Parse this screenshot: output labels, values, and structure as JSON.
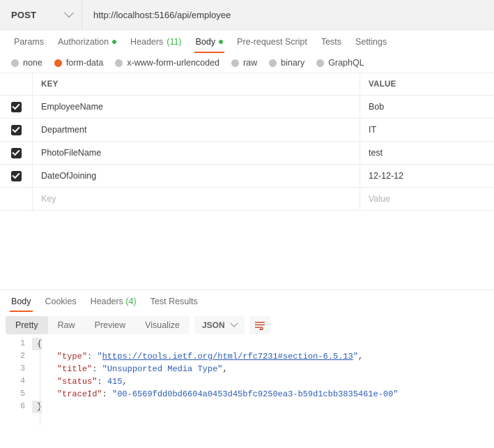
{
  "request": {
    "method": "POST",
    "url": "http://localhost:5166/api/employee",
    "tabs": [
      {
        "label": "Params",
        "dot": false,
        "count": ""
      },
      {
        "label": "Authorization",
        "dot": true,
        "count": ""
      },
      {
        "label": "Headers",
        "dot": false,
        "count": "(11)"
      },
      {
        "label": "Body",
        "dot": true,
        "count": ""
      },
      {
        "label": "Pre-request Script",
        "dot": false,
        "count": ""
      },
      {
        "label": "Tests",
        "dot": false,
        "count": ""
      },
      {
        "label": "Settings",
        "dot": false,
        "count": ""
      }
    ],
    "active_tab": "Body",
    "body_types": [
      {
        "label": "none",
        "selected": false
      },
      {
        "label": "form-data",
        "selected": true
      },
      {
        "label": "x-www-form-urlencoded",
        "selected": false
      },
      {
        "label": "raw",
        "selected": false
      },
      {
        "label": "binary",
        "selected": false
      },
      {
        "label": "GraphQL",
        "selected": false
      }
    ],
    "table": {
      "columns": {
        "key": "KEY",
        "value": "VALUE"
      },
      "rows": [
        {
          "checked": true,
          "key": "EmployeeName",
          "value": "Bob"
        },
        {
          "checked": true,
          "key": "Department",
          "value": "IT"
        },
        {
          "checked": true,
          "key": "PhotoFileName",
          "value": "test"
        },
        {
          "checked": true,
          "key": "DateOfJoining",
          "value": "12-12-12"
        }
      ],
      "new_row": {
        "key_placeholder": "Key",
        "value_placeholder": "Value"
      }
    }
  },
  "response": {
    "tabs": [
      {
        "label": "Body",
        "count": ""
      },
      {
        "label": "Cookies",
        "count": ""
      },
      {
        "label": "Headers",
        "count": "(4)"
      },
      {
        "label": "Test Results",
        "count": ""
      }
    ],
    "active_tab": "Body",
    "view_modes": [
      "Pretty",
      "Raw",
      "Preview",
      "Visualize"
    ],
    "active_view": "Pretty",
    "format": "JSON",
    "wrap_icon": "wrap-text-icon",
    "code": {
      "lines": [
        "1",
        "2",
        "3",
        "4",
        "5",
        "6"
      ],
      "l1": "{",
      "l2_key": "\"type\"",
      "l2_url": "https://tools.ietf.org/html/rfc7231#section-6.5.13",
      "l3_key": "\"title\"",
      "l3_val": "\"Unsupported Media Type\"",
      "l4_key": "\"status\"",
      "l4_val": "415",
      "l5_key": "\"traceId\"",
      "l5_val": "\"00-6569fdd0bd6604a0453d45bfc9250ea3-b59d1cbb3835461e-00\"",
      "l6": "}"
    }
  },
  "colors": {
    "accent": "#ef5b25",
    "green": "#3bb44a",
    "orange_radio": "#f26522",
    "string": "#2a5db0",
    "key": "#a52a2a"
  }
}
